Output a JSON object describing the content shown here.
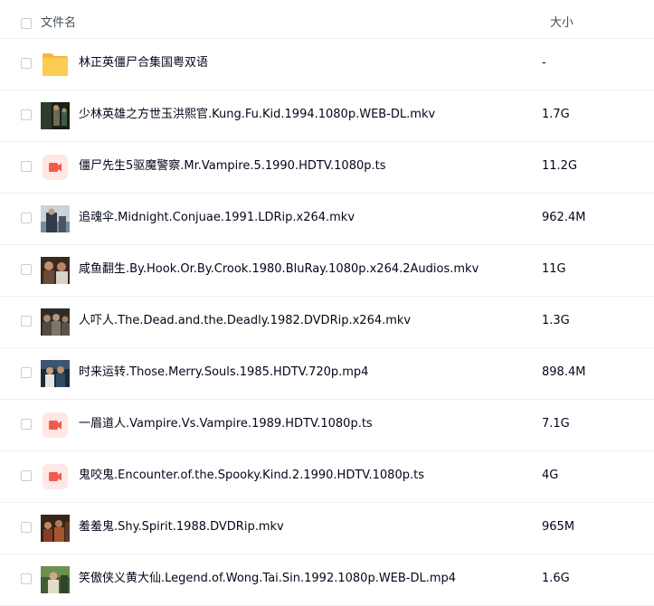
{
  "header": {
    "name_label": "文件名",
    "size_label": "大小"
  },
  "files": [
    {
      "name": "林正英僵尸合集国粤双语",
      "size": "-",
      "icon": "folder-icon"
    },
    {
      "name": "少林英雄之方世玉洪熙官.Kung.Fu.Kid.1994.1080p.WEB-DL.mkv",
      "size": "1.7G",
      "icon": "video-thumbnail"
    },
    {
      "name": "僵尸先生5驱魔警察.Mr.Vampire.5.1990.HDTV.1080p.ts",
      "size": "11.2G",
      "icon": "video-file-icon"
    },
    {
      "name": "追魂伞.Midnight.Conjuae.1991.LDRip.x264.mkv",
      "size": "962.4M",
      "icon": "video-thumbnail"
    },
    {
      "name": "咸鱼翻生.By.Hook.Or.By.Crook.1980.BluRay.1080p.x264.2Audios.mkv",
      "size": "11G",
      "icon": "video-thumbnail"
    },
    {
      "name": "人吓人.The.Dead.and.the.Deadly.1982.DVDRip.x264.mkv",
      "size": "1.3G",
      "icon": "video-thumbnail"
    },
    {
      "name": "时来运转.Those.Merry.Souls.1985.HDTV.720p.mp4",
      "size": "898.4M",
      "icon": "video-thumbnail"
    },
    {
      "name": "一眉道人.Vampire.Vs.Vampire.1989.HDTV.1080p.ts",
      "size": "7.1G",
      "icon": "video-file-icon"
    },
    {
      "name": "鬼咬鬼.Encounter.of.the.Spooky.Kind.2.1990.HDTV.1080p.ts",
      "size": "4G",
      "icon": "video-file-icon"
    },
    {
      "name": "羞羞鬼.Shy.Spirit.1988.DVDRip.mkv",
      "size": "965M",
      "icon": "video-thumbnail"
    },
    {
      "name": "笑傲侠义黄大仙.Legend.of.Wong.Tai.Sin.1992.1080p.WEB-DL.mp4",
      "size": "1.6G",
      "icon": "video-thumbnail"
    }
  ],
  "colors": {
    "folder": "#f8c34b",
    "video_icon_bg": "#ffe7e5",
    "video_icon_fg": "#f4594a",
    "divider": "#eef0f4",
    "text": "#03081a",
    "header_text": "#454d5a"
  }
}
